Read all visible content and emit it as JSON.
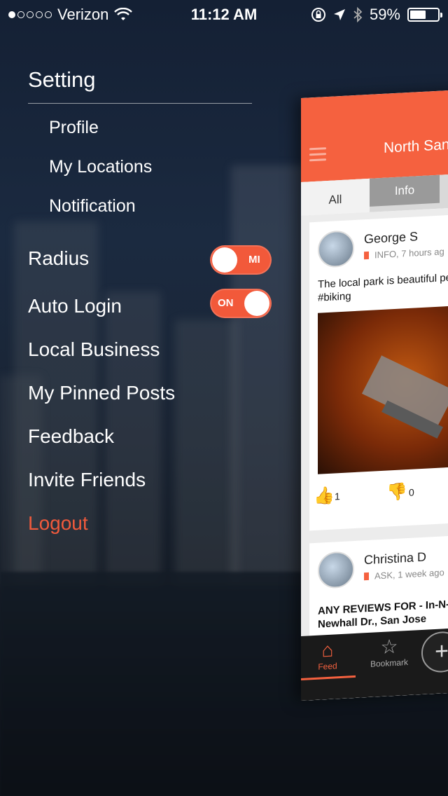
{
  "status": {
    "carrier": "Verizon",
    "time": "11:12 AM",
    "battery": "59%",
    "battery_level": 0.59,
    "signal_bars": 1
  },
  "menu": {
    "title": "Setting",
    "sub_items": [
      "Profile",
      "My Locations",
      "Notification"
    ],
    "radius_label": "Radius",
    "radius_toggle": "MI",
    "auto_login_label": "Auto Login",
    "auto_login_toggle": "ON",
    "items": [
      "Local Business",
      "My Pinned Posts",
      "Feedback",
      "Invite Friends"
    ],
    "logout": "Logout"
  },
  "panel": {
    "header_title": "North San",
    "tabs": [
      "All",
      "Info"
    ],
    "posts": [
      {
        "author": "George S",
        "meta": "INFO, 7 hours ag",
        "text": "The local park is beautiful perfect #biking",
        "up_votes": "1",
        "down_votes": "0"
      },
      {
        "author": "Christina D",
        "meta": "ASK, 1 week ago",
        "text": "ANY REVIEWS FOR - In-N- Newhall Dr., San Jose"
      }
    ],
    "bottom_nav": {
      "feed": "Feed",
      "bookmark": "Bookmark",
      "add": "+"
    }
  },
  "colors": {
    "accent": "#f5613f",
    "logout": "#f05a3c"
  },
  "icons": [
    "wifi-icon",
    "lock-rotation-icon",
    "location-arrow-icon",
    "bluetooth-icon",
    "battery-icon",
    "hamburger-icon",
    "thumbs-up-icon",
    "thumbs-down-icon",
    "home-icon",
    "star-icon",
    "plus-icon"
  ]
}
